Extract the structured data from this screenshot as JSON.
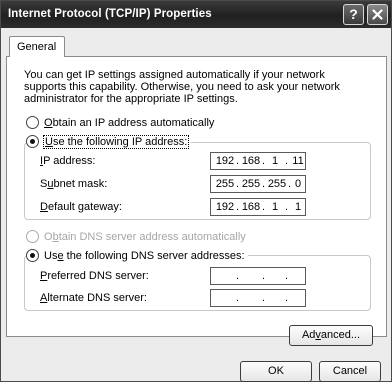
{
  "window": {
    "title": "Internet Protocol (TCP/IP) Properties",
    "help_glyph": "?"
  },
  "tabs": [
    {
      "label": "General"
    }
  ],
  "intro_text": "You can get IP settings assigned automatically if your network supports this capability. Otherwise, you need to ask your network administrator for the appropriate IP settings.",
  "ip_mode": {
    "auto": {
      "label": "Obtain an IP address automatically",
      "selected": false
    },
    "manual": {
      "label": "Use the following IP address:",
      "selected": true
    }
  },
  "ip_fields": [
    {
      "label": "IP address:",
      "octets": [
        "192",
        "168",
        "1",
        "11"
      ]
    },
    {
      "label": "Subnet mask:",
      "octets": [
        "255",
        "255",
        "255",
        "0"
      ]
    },
    {
      "label": "Default gateway:",
      "octets": [
        "192",
        "168",
        "1",
        "1"
      ]
    }
  ],
  "dns_mode": {
    "auto": {
      "label": "Obtain DNS server address automatically",
      "selected": false,
      "disabled": true
    },
    "manual": {
      "label": "Use the following DNS server addresses:",
      "selected": true
    }
  },
  "dns_fields": [
    {
      "label": "Preferred DNS server:",
      "octets": [
        "",
        "",
        "",
        ""
      ]
    },
    {
      "label": "Alternate DNS server:",
      "octets": [
        "",
        "",
        "",
        ""
      ]
    }
  ],
  "buttons": {
    "advanced": "Advanced...",
    "ok": "OK",
    "cancel": "Cancel"
  }
}
